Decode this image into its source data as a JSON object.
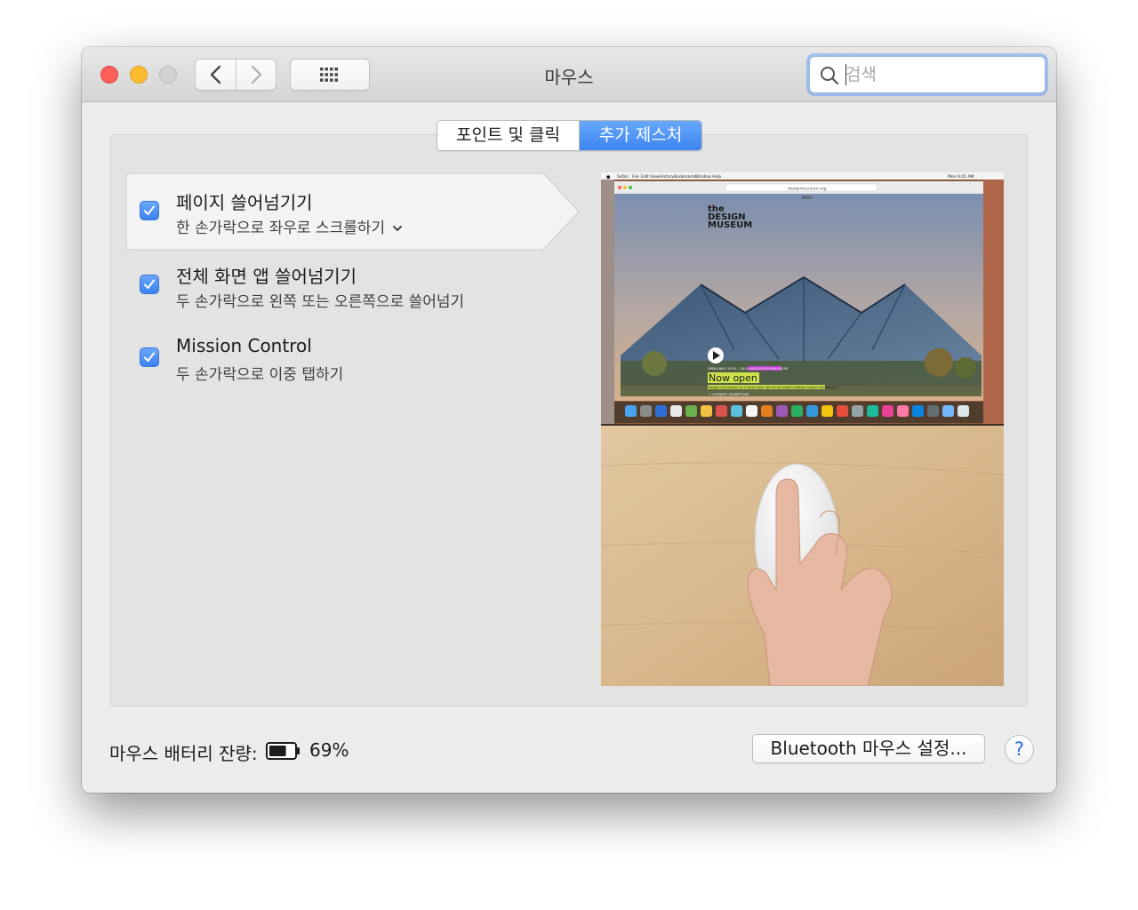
{
  "window": {
    "title": "마우스",
    "search_placeholder": "검색"
  },
  "tabs": [
    {
      "label": "포인트 및 클릭",
      "selected": false
    },
    {
      "label": "추가 제스처",
      "selected": true
    }
  ],
  "gestures": [
    {
      "title": "페이지 쓸어넘기기",
      "subtitle": "한 손가락으로 좌우로 스크롤하기",
      "checked": true,
      "selected": true,
      "has_dropdown": true
    },
    {
      "title": "전체 화면 앱 쓸어넘기기",
      "subtitle": "두 손가락으로 왼쪽 또는 오른쪽으로 쓸어넘기",
      "checked": true,
      "selected": false,
      "has_dropdown": false
    },
    {
      "title": "Mission Control",
      "subtitle": "두 손가락으로 이중 탭하기",
      "checked": true,
      "selected": false,
      "has_dropdown": false
    }
  ],
  "preview": {
    "menubar_items": [
      "Safari",
      "File",
      "Edit",
      "View",
      "History",
      "Bookmarks",
      "Window",
      "Help"
    ],
    "menubar_clock": "Mon 9:41 AM",
    "url": "designmuseum.org",
    "menu_label": "MENU",
    "site_logo": [
      "the",
      "DESIGN",
      "MUSEUM"
    ],
    "now_open": "Now open",
    "open_daily": "OPEN DAILY 10.00 – 18.00",
    "hashtag": "#INSIDEDESIGNMUSEUM",
    "tagline": "Design is all around us. It never stops. We are the world's leading museum devoted to it.",
    "current_exhibitions": "+ CURRENT EXHIBITIONS"
  },
  "footer": {
    "battery_label": "마우스 배터리 잔량:",
    "battery_percent": "69%",
    "battery_level": 0.69,
    "bluetooth_button": "Bluetooth 마우스 설정...",
    "help_label": "?"
  },
  "colors": {
    "accent": "#3d85f0",
    "close": "#fc5f57",
    "minimize": "#fdbc2e",
    "zoom_disabled": "#d1d1d1"
  },
  "icons": {
    "back": "chevron-left-icon",
    "forward": "chevron-right-icon",
    "show_all": "grid-icon",
    "search": "search-icon",
    "checkbox": "checkmark-icon",
    "battery": "battery-icon",
    "help": "help-icon"
  }
}
